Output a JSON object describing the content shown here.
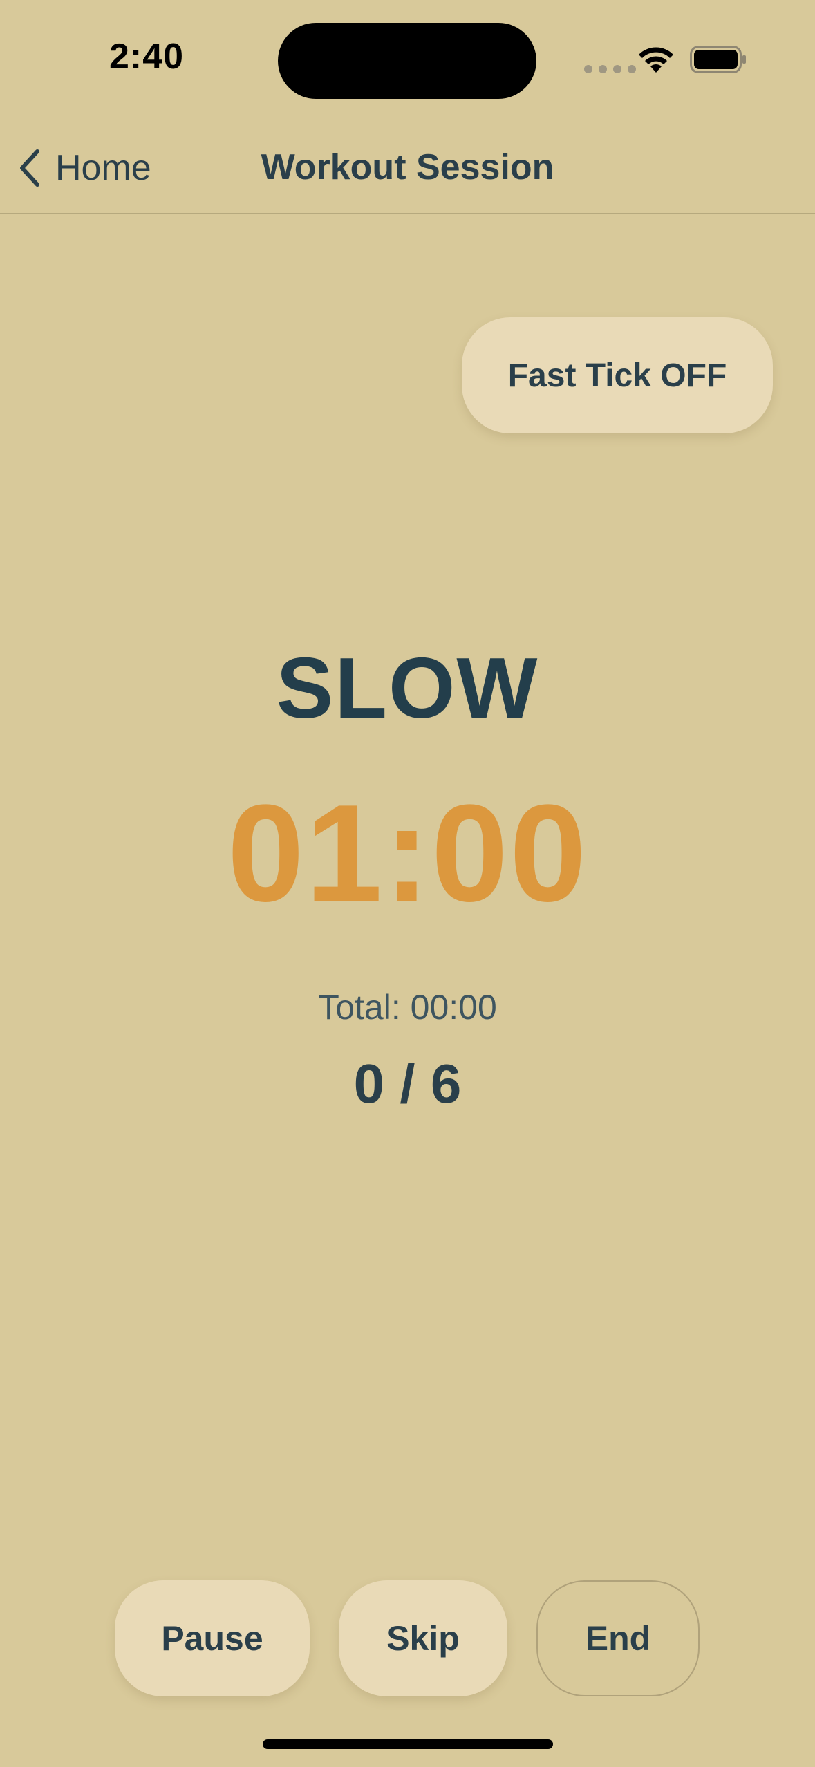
{
  "status_bar": {
    "time": "2:40",
    "icons": [
      "signal-icon",
      "wifi-icon",
      "battery-icon"
    ]
  },
  "nav": {
    "back_label": "Home",
    "title": "Workout Session"
  },
  "fast_tick": {
    "label": "Fast Tick OFF"
  },
  "session": {
    "phase": "SLOW",
    "countdown": "01:00",
    "total": "Total: 00:00",
    "progress": "0 / 6"
  },
  "controls": {
    "pause_label": "Pause",
    "skip_label": "Skip",
    "end_label": "End"
  },
  "colors": {
    "background": "#D8C99A",
    "text": "#2A3F4A",
    "accent": "#DC983E",
    "button_fill": "#E9DAB7"
  }
}
